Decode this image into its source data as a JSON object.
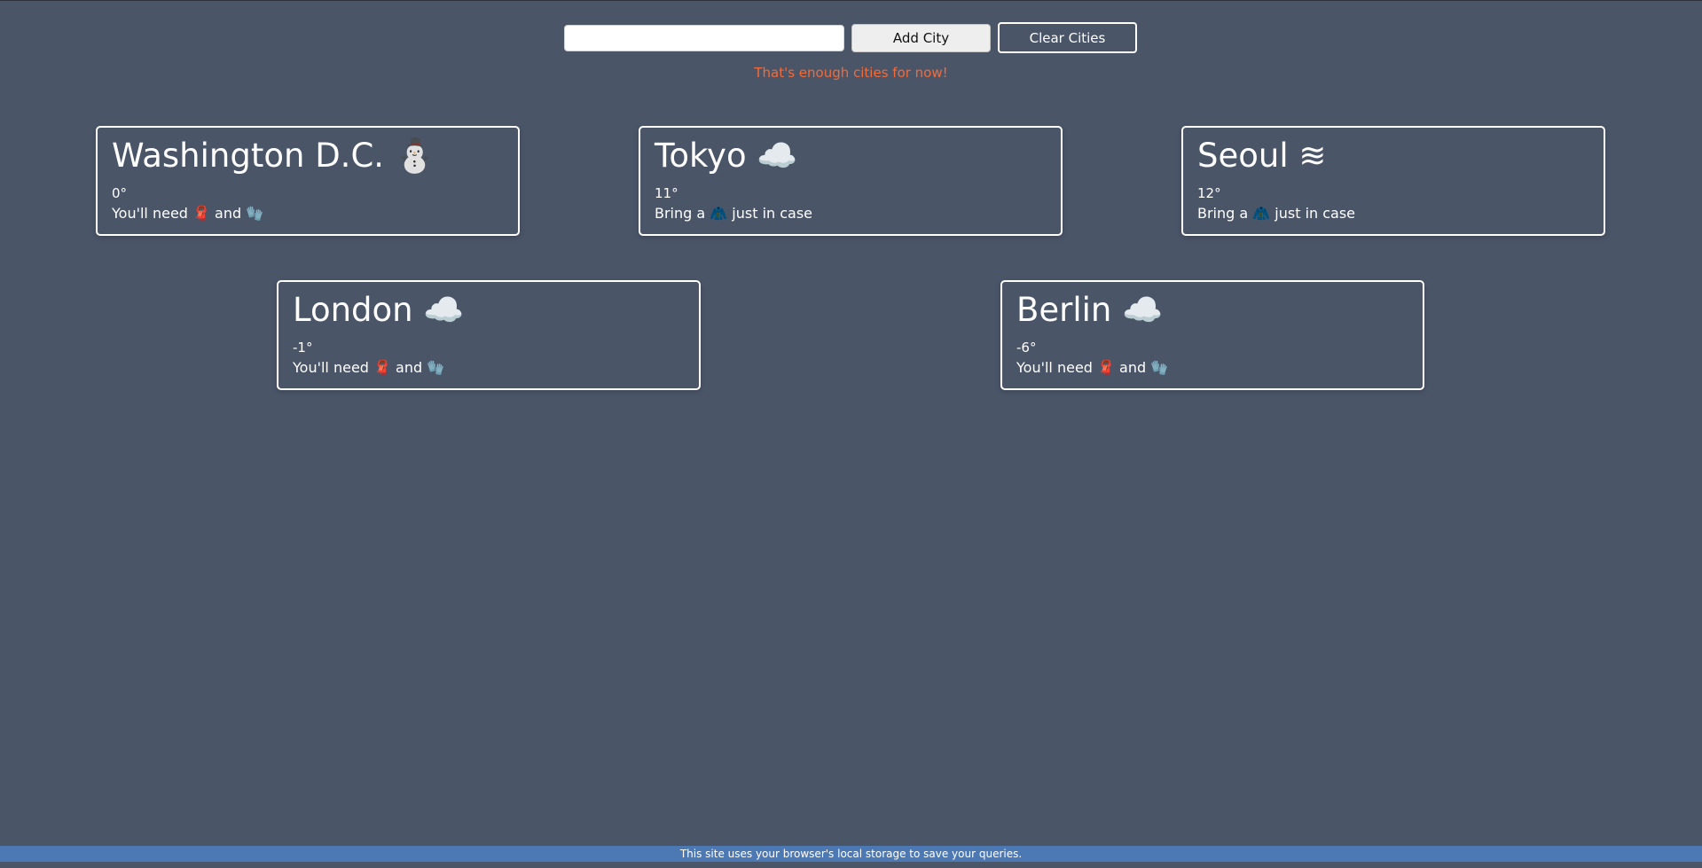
{
  "controls": {
    "input_value": "",
    "add_label": "Add City",
    "clear_label": "Clear Cities"
  },
  "notice": "That's enough cities for now!",
  "cities": [
    {
      "title": "Washington D.C. ⛄",
      "temp": "0°",
      "advice": "You'll need 🧣 and 🧤"
    },
    {
      "title": "Tokyo ☁️",
      "temp": "11°",
      "advice": "Bring a 🧥 just in case"
    },
    {
      "title": "Seoul ≋",
      "temp": "12°",
      "advice": "Bring a 🧥 just in case"
    },
    {
      "title": "London ☁️",
      "temp": "-1°",
      "advice": "You'll need 🧣 and 🧤"
    },
    {
      "title": "Berlin ☁️",
      "temp": "-6°",
      "advice": "You'll need 🧣 and 🧤"
    }
  ],
  "footer": "This site uses your browser's local storage to save your queries.",
  "colors": {
    "background": "#4a5568",
    "notice": "#f26b3a",
    "footer": "#4c79b3"
  }
}
